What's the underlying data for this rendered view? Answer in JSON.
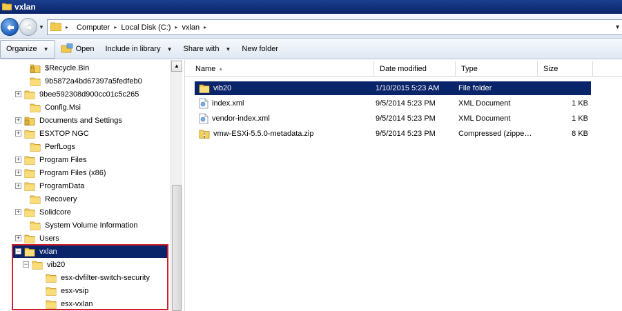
{
  "window": {
    "title": "vxlan"
  },
  "address_bar": {
    "breadcrumbs": [
      "Computer",
      "Local Disk (C:)",
      "vxlan"
    ]
  },
  "toolbar": {
    "organize": "Organize",
    "open": "Open",
    "include_in_library": "Include in library",
    "share_with": "Share with",
    "new_folder": "New folder"
  },
  "tree": [
    {
      "label": "$Recycle.Bin",
      "expander": "",
      "locked": true
    },
    {
      "label": "9b5872a4bd67397a5fedfeb0",
      "expander": "",
      "locked": false
    },
    {
      "label": "9bee592308d900cc01c5c265",
      "expander": "+",
      "locked": false
    },
    {
      "label": "Config.Msi",
      "expander": "",
      "locked": false
    },
    {
      "label": "Documents and Settings",
      "expander": "+",
      "locked": true
    },
    {
      "label": "ESXTOP NGC",
      "expander": "+",
      "locked": false
    },
    {
      "label": "PerfLogs",
      "expander": "",
      "locked": false
    },
    {
      "label": "Program Files",
      "expander": "+",
      "locked": false
    },
    {
      "label": "Program Files (x86)",
      "expander": "+",
      "locked": false
    },
    {
      "label": "ProgramData",
      "expander": "+",
      "locked": false
    },
    {
      "label": "Recovery",
      "expander": "",
      "locked": false
    },
    {
      "label": "Solidcore",
      "expander": "+",
      "locked": false
    },
    {
      "label": "System Volume Information",
      "expander": "",
      "locked": false
    },
    {
      "label": "Users",
      "expander": "+",
      "locked": false
    },
    {
      "label": "vxlan",
      "expander": "−",
      "locked": false,
      "selected": true
    },
    {
      "label": "vib20",
      "expander": "−",
      "locked": false
    },
    {
      "label": "esx-dvfilter-switch-security",
      "expander": "",
      "locked": false
    },
    {
      "label": "esx-vsip",
      "expander": "",
      "locked": false
    },
    {
      "label": "esx-vxlan",
      "expander": "",
      "locked": false
    }
  ],
  "columns": [
    "Name",
    "Date modified",
    "Type",
    "Size"
  ],
  "files": [
    {
      "name": "vib20",
      "date": "1/10/2015 5:23 AM",
      "type": "File folder",
      "size": "",
      "icon": "folder-icon",
      "selected": true
    },
    {
      "name": "index.xml",
      "date": "9/5/2014 5:23 PM",
      "type": "XML Document",
      "size": "1 KB",
      "icon": "xml-file-icon"
    },
    {
      "name": "vendor-index.xml",
      "date": "9/5/2014 5:23 PM",
      "type": "XML Document",
      "size": "1 KB",
      "icon": "xml-file-icon"
    },
    {
      "name": "vmw-ESXi-5.5.0-metadata.zip",
      "date": "9/5/2014 5:23 PM",
      "type": "Compressed (zippe…",
      "size": "8 KB",
      "icon": "zip-folder-icon"
    }
  ],
  "colors": {
    "selection": "#0a246a",
    "title_bar": "#0a246a",
    "highlight_box": "#d0202e"
  }
}
